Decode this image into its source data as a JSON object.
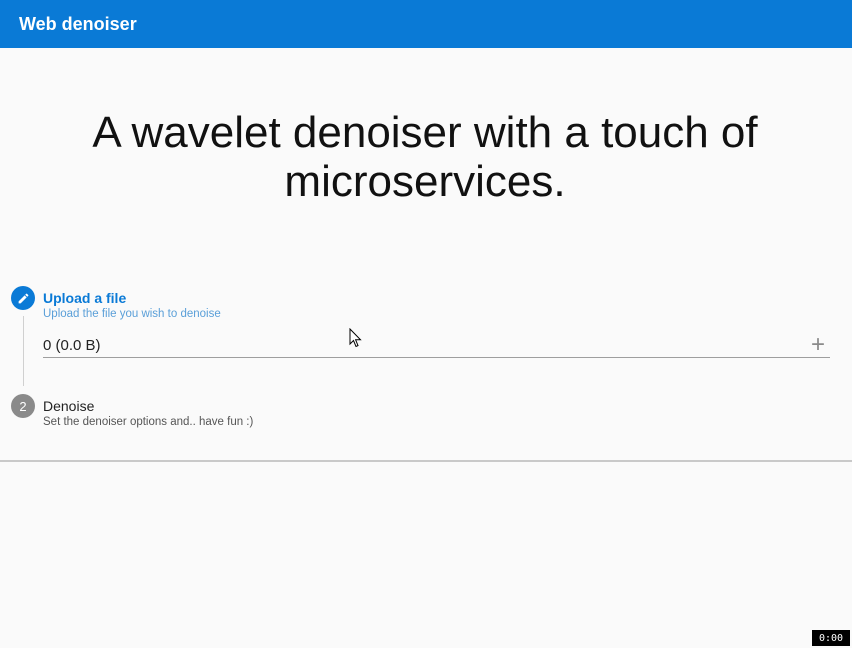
{
  "app": {
    "title": "Web denoiser"
  },
  "hero": {
    "text": "A wavelet denoiser with a touch of microservices."
  },
  "steps": [
    {
      "title": "Upload a file",
      "subtitle": "Upload the file you wish to denoise",
      "icon": "pencil-icon",
      "file_value": "0 (0.0 B)",
      "add_label": "+"
    },
    {
      "number": "2",
      "title": "Denoise",
      "subtitle": "Set the denoiser options and.. have fun :)"
    }
  ],
  "recording": {
    "time": "0:00"
  },
  "colors": {
    "accent": "#0a7ad6",
    "inactive_step": "#8a8a8a"
  }
}
